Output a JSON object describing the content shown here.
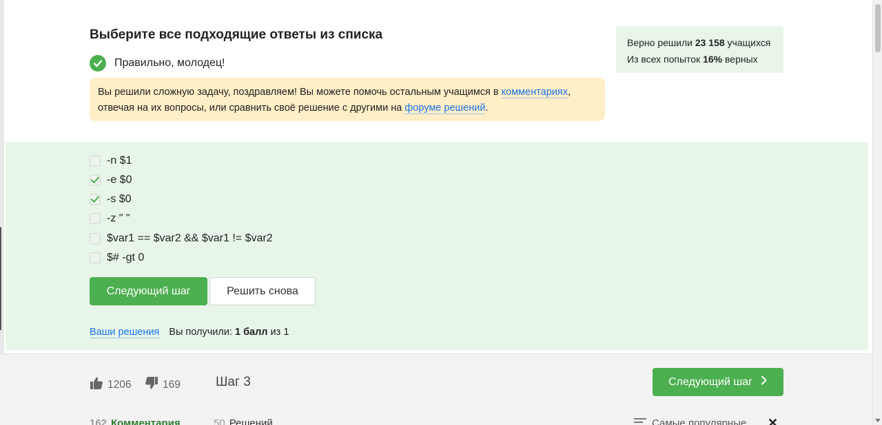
{
  "task": {
    "title": "Выберите все подходящие ответы из списка",
    "status_text": "Правильно, молодец!"
  },
  "notice": {
    "part1": "Вы решили сложную задачу, поздравляем! Вы можете помочь остальным учащимся в ",
    "comments_link": "комментариях",
    "part2": ", отвечая на их вопросы, или сравнить своё решение с другими на ",
    "forum_link": "форуме решений",
    "part3": "."
  },
  "stats": {
    "solved_prefix": "Верно решили ",
    "solved_count": "23 158",
    "solved_suffix": " учащихся",
    "attempts_prefix": "Из всех попыток ",
    "attempts_percent": "16%",
    "attempts_suffix": " верных"
  },
  "options": [
    {
      "label": "-n $1",
      "checked": false
    },
    {
      "label": "-e $0",
      "checked": true
    },
    {
      "label": "-s $0",
      "checked": true
    },
    {
      "label": "-z \" \"",
      "checked": false
    },
    {
      "label": "$var1 == $var2 && $var1 != $var2",
      "checked": false
    },
    {
      "label": "$# -gt 0",
      "checked": false
    }
  ],
  "buttons": {
    "next_step": "Следующий шаг",
    "solve_again": "Решить снова"
  },
  "result": {
    "your_solutions": "Ваши решения",
    "received_prefix": "Вы получили: ",
    "score": "1 балл",
    "of_text": " из 1"
  },
  "footer": {
    "likes": "1206",
    "dislikes": "169",
    "step_label": "Шаг 3",
    "next_step": "Следующий шаг",
    "comments_count": "162",
    "comments_label": "Комментария",
    "solutions_count": "50",
    "solutions_label": "Решений",
    "sort_label": "Самые популярные"
  },
  "colors": {
    "accent_green": "#4caf50",
    "link_blue": "#1a73e8",
    "notice_bg": "#ffeec6",
    "answers_bg": "#e7f6e8"
  }
}
